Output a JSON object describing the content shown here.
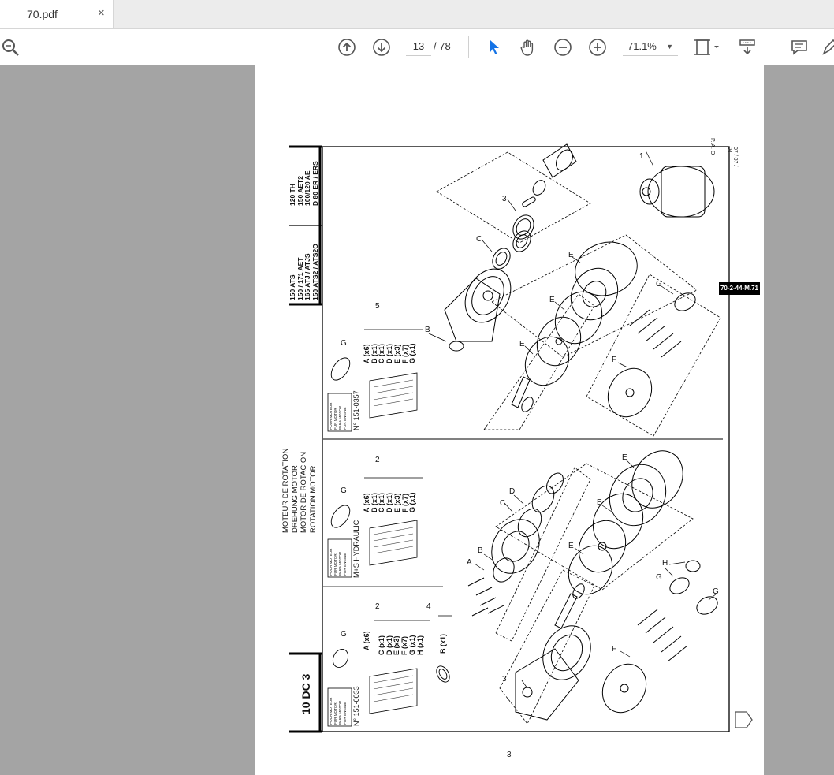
{
  "tab": {
    "title": "70.pdf",
    "close": "×"
  },
  "toolbar": {
    "page_current": "13",
    "page_total": "/ 78",
    "zoom": "71.1%",
    "icons": [
      "search-icon",
      "arrow-up-icon",
      "arrow-down-icon",
      "pointer-icon",
      "hand-icon",
      "zoom-out-icon",
      "zoom-in-icon",
      "fit-page-icon",
      "scroll-mode-icon",
      "comment-icon",
      "pen-icon"
    ]
  },
  "document": {
    "page_number_footer": "3",
    "badge": "70-2-44-M.71",
    "pao": "P. A. O",
    "date": "07 / 07 / 04",
    "model_left": "10 DC 3",
    "models_mid": [
      "150 ATS",
      "150 / 171 AET",
      "165 ATJ / ATJS",
      "150 ATS2 / ATS2O"
    ],
    "models_right": [
      "120 TH",
      "150 AET2",
      "100/120 AE",
      "D 80 ER / ERS"
    ],
    "title_lines": [
      "MOTEUR DE ROTATION",
      "DREHUNG MOTOR",
      "MOTOR DE ROTACION",
      "ROTATION MOTOR"
    ],
    "kit_left": "151-0033",
    "kit_mid": "M+S HYDRAULIC",
    "kit_right": "151-0357",
    "kit_prefix": "N°",
    "label_box": [
      "POUR MOTEUR",
      "FUR MOTOR",
      "PARA MOTOR",
      "FOR ENGINE"
    ],
    "parts_left": [
      "A (x6)",
      "C (x1)",
      "D (x1)",
      "E (x3)",
      "F (x7)",
      "G (x1)",
      "H (x1)"
    ],
    "parts_left_b": "B (x1)",
    "parts_mid": [
      "A (x6)",
      "B (x1)",
      "C (x1)",
      "D (x1)",
      "E (x3)",
      "F (x7)",
      "G (x1)"
    ],
    "parts_right": [
      "A (x6)",
      "B (x1)",
      "C (x1)",
      "D (x1)",
      "E (x3)",
      "F (x7)",
      "G (x1)"
    ],
    "ref_numbers": {
      "n1": "1",
      "n2": "2",
      "n3": "3",
      "n4": "4",
      "n5": "5"
    },
    "letters": {
      "a": "A",
      "b": "B",
      "c": "C",
      "d": "D",
      "e": "E",
      "f": "F",
      "g": "G",
      "h": "H"
    }
  }
}
